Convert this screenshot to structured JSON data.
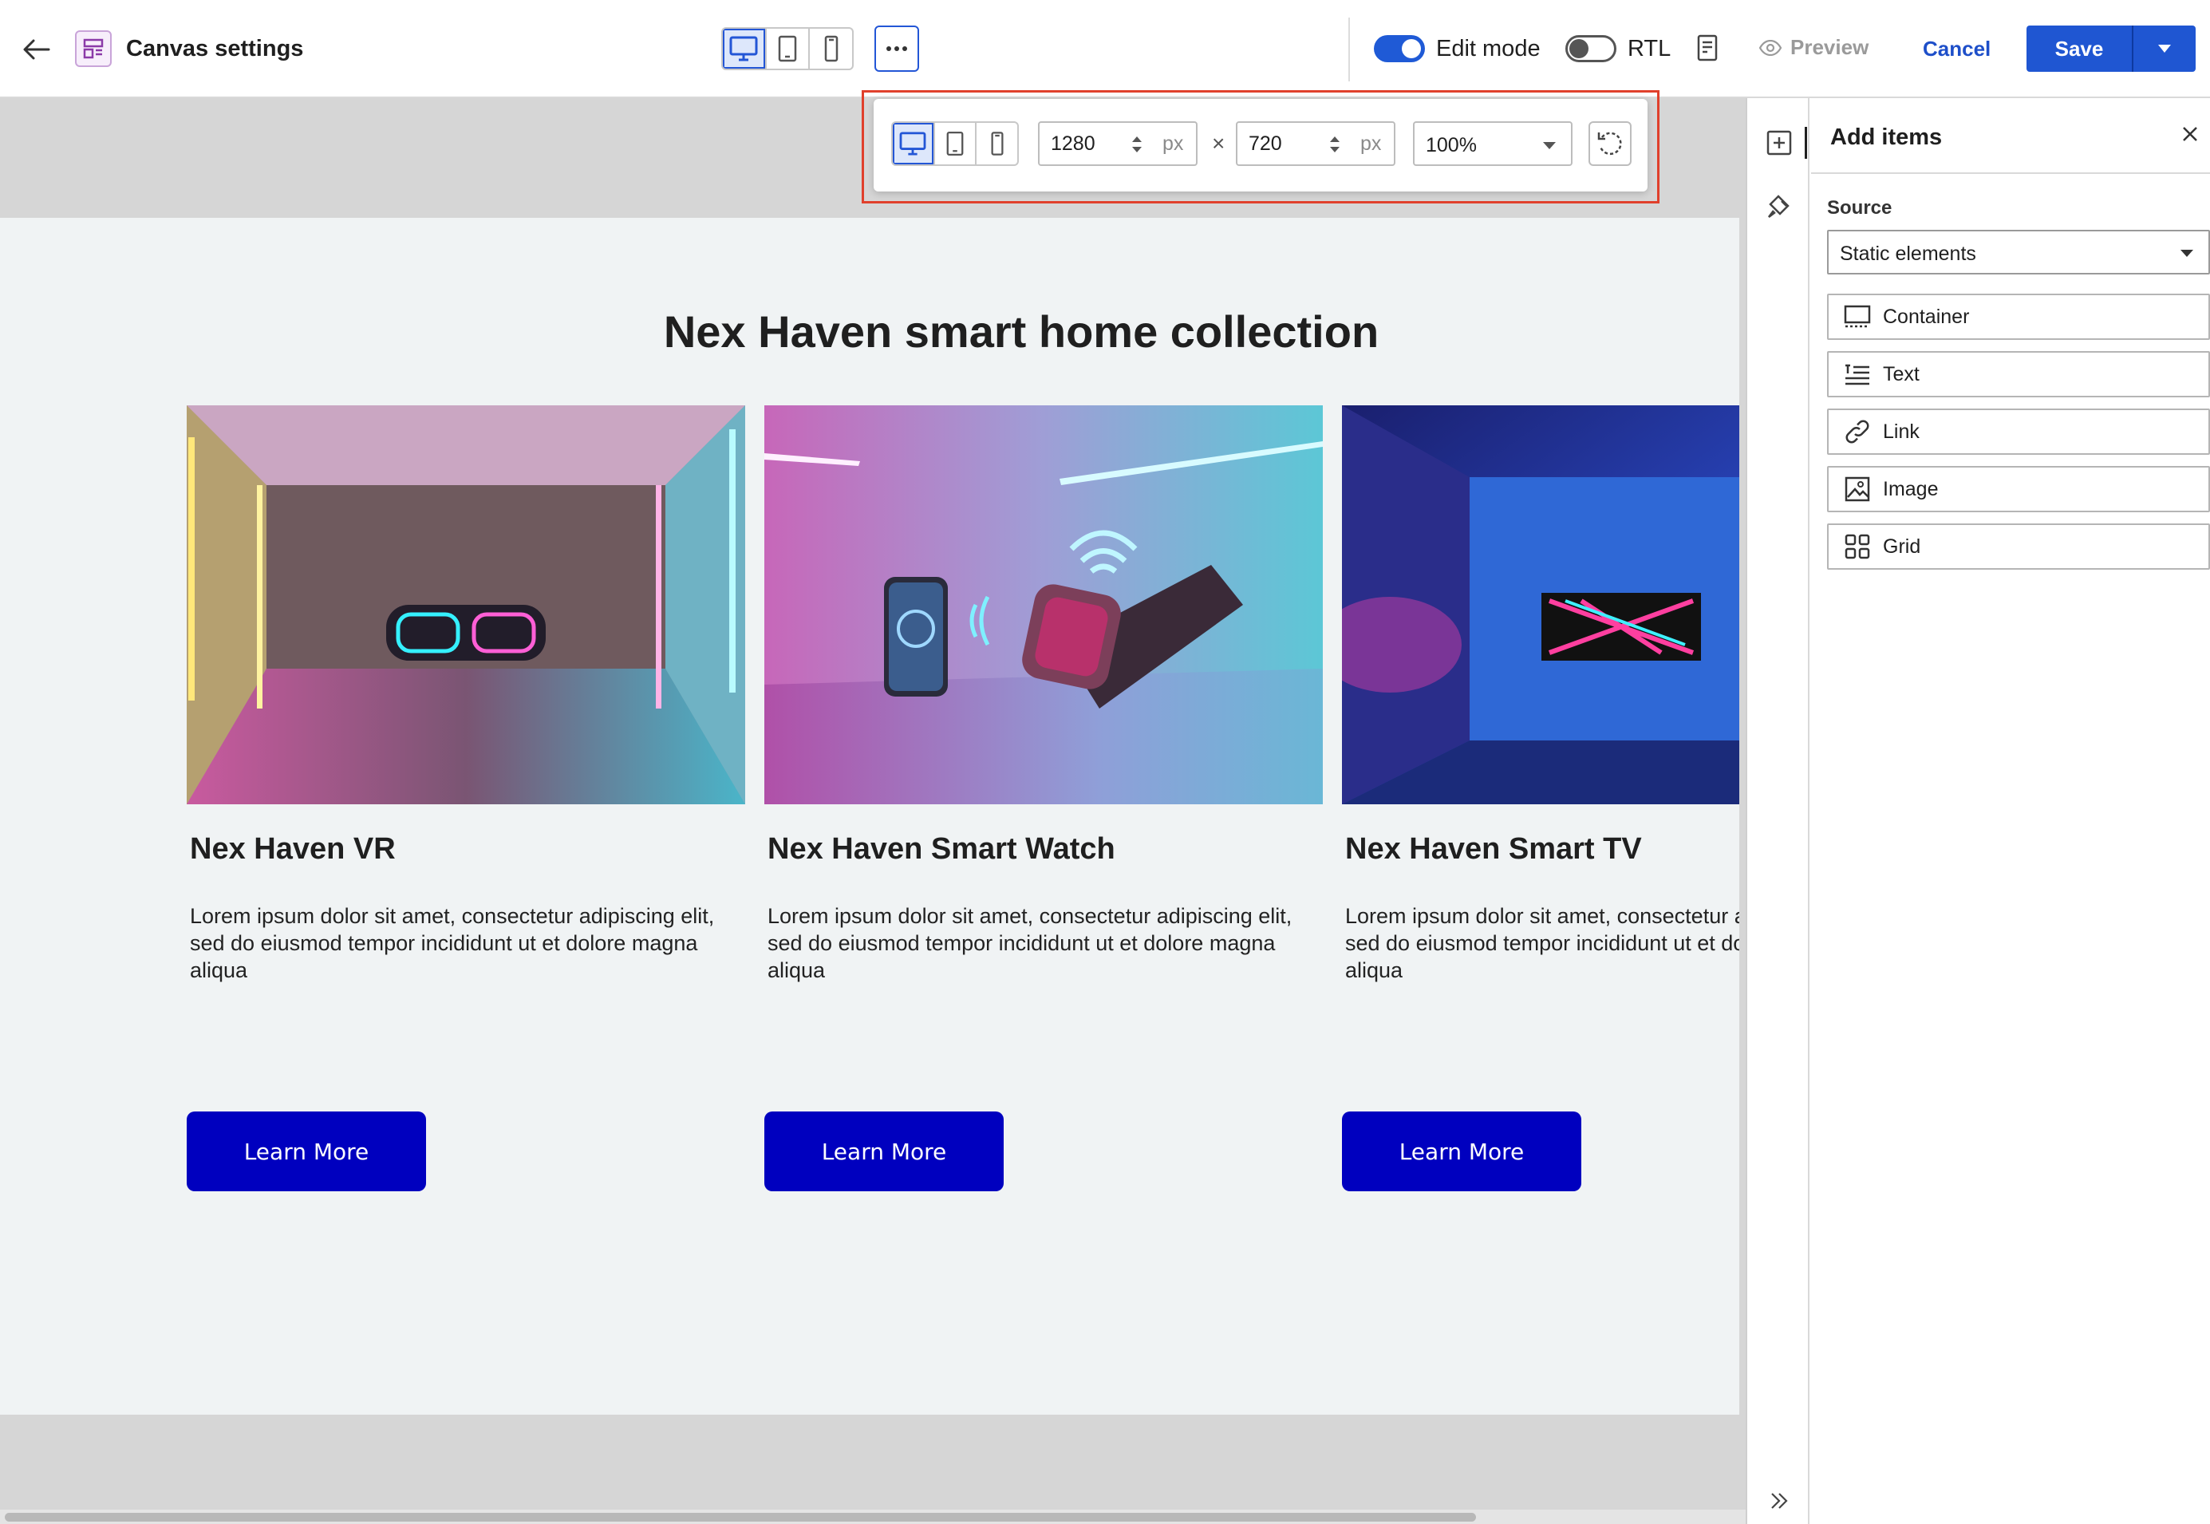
{
  "header": {
    "back_icon": "arrow-left-icon",
    "app_icon": "layout-icon",
    "title": "Canvas settings",
    "devices": [
      "desktop",
      "tablet",
      "mobile"
    ],
    "active_device": "desktop",
    "more_icon": "ellipsis-icon",
    "edit_mode_label": "Edit mode",
    "edit_mode_on": true,
    "rtl_label": "RTL",
    "rtl_on": false,
    "notes_icon": "document-icon",
    "preview_label": "Preview",
    "cancel_label": "Cancel",
    "save_label": "Save"
  },
  "canvas_toolbar": {
    "width": "1280",
    "height": "720",
    "unit": "px",
    "times": "×",
    "zoom": "100%",
    "reset_icon": "rotate-reset-icon"
  },
  "page": {
    "title": "Nex Haven smart home collection",
    "cards": [
      {
        "title": "Nex Haven VR",
        "description": "Lorem ipsum dolor sit amet, consectetur adipiscing elit, sed do eiusmod tempor incididunt ut et dolore magna aliqua",
        "button": "Learn More"
      },
      {
        "title": "Nex Haven Smart Watch",
        "description": "Lorem ipsum dolor sit amet, consectetur adipiscing elit, sed do eiusmod tempor incididunt ut et dolore magna aliqua",
        "button": "Learn More"
      },
      {
        "title": "Nex Haven Smart TV",
        "description": "Lorem ipsum dolor sit amet, consectetur adipiscing elit, sed do eiusmod tempor incididunt ut et dolore magna aliqua",
        "button": "Learn More"
      }
    ]
  },
  "panel": {
    "title": "Add items",
    "source_label": "Source",
    "source_value": "Static elements",
    "items": [
      {
        "label": "Container",
        "icon": "container-icon"
      },
      {
        "label": "Text",
        "icon": "text-icon"
      },
      {
        "label": "Link",
        "icon": "link-icon"
      },
      {
        "label": "Image",
        "icon": "image-icon"
      },
      {
        "label": "Grid",
        "icon": "grid-icon"
      }
    ]
  },
  "colors": {
    "accent": "#1f56d2",
    "button": "#0000bf",
    "highlight": "#e0402c"
  }
}
